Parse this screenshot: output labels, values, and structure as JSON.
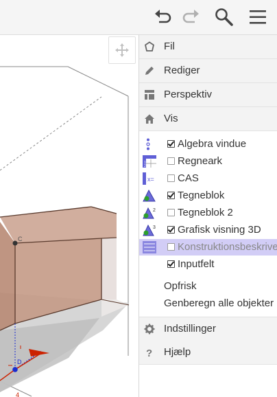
{
  "toolbar": {
    "icons": [
      "undo-icon",
      "redo-icon",
      "search-icon",
      "menu-icon"
    ]
  },
  "graphics": {
    "point_labels": [
      "D",
      "4"
    ],
    "colors": {
      "solid_fill": "#c49a86",
      "solid_edge": "#5a3b2e",
      "ground": "#b9b9b9",
      "axis_red": "#cc2200",
      "axis_blue": "#1a2bd0"
    }
  },
  "menu": {
    "fil": "Fil",
    "rediger": "Rediger",
    "perspektiv": "Perspektiv",
    "vis": "Vis",
    "vis_items": [
      {
        "label": "Algebra vindue",
        "checked": true,
        "icon": "algebra-view-icon"
      },
      {
        "label": "Regneark",
        "checked": false,
        "icon": "spreadsheet-icon"
      },
      {
        "label": "CAS",
        "checked": false,
        "icon": "cas-icon"
      },
      {
        "label": "Tegneblok",
        "checked": true,
        "icon": "graphics-icon"
      },
      {
        "label": "Tegneblok 2",
        "checked": false,
        "icon": "graphics-2-icon"
      },
      {
        "label": "Grafisk visning 3D",
        "checked": true,
        "icon": "graphics-3d-icon"
      },
      {
        "label": "Konstruktionsbeskrivelse",
        "checked": false,
        "icon": "construction-protocol-icon"
      },
      {
        "label": "Inputfelt",
        "checked": true,
        "icon": ""
      }
    ],
    "opfrisk": "Opfrisk",
    "genberegn": "Genberegn alle objekter",
    "indstillinger": "Indstillinger",
    "hjaelp": "Hjælp"
  }
}
